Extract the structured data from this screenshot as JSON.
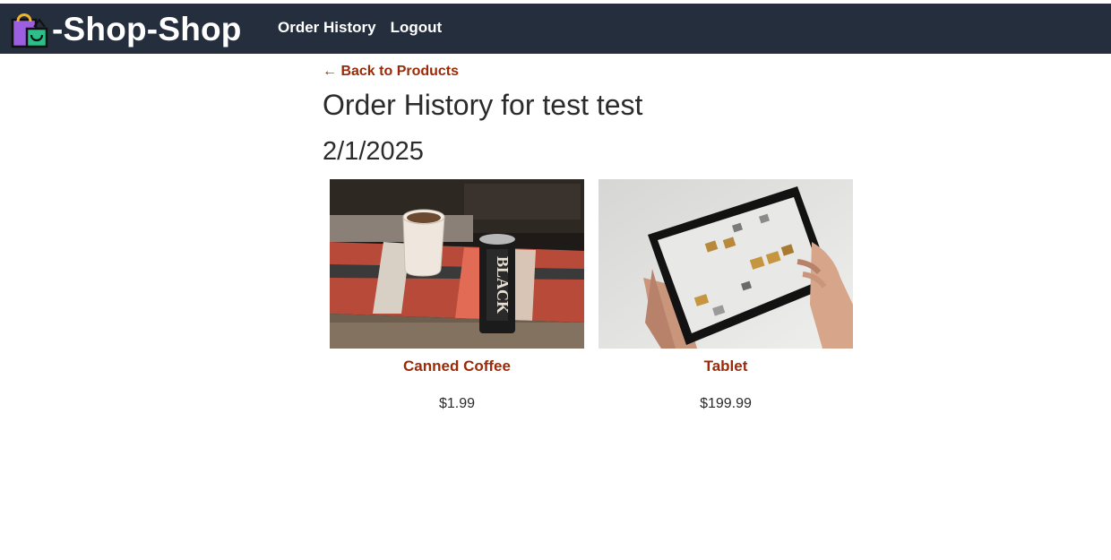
{
  "header": {
    "brand_icon": "shopping-bag-icon",
    "brand_text": "-Shop-Shop",
    "nav": [
      {
        "label": "Order History"
      },
      {
        "label": "Logout"
      }
    ],
    "background": "#252e3d"
  },
  "main": {
    "back_link": "← Back to Products",
    "title": "Order History for test test",
    "orders": [
      {
        "date": "2/1/2025",
        "items": [
          {
            "name": "Canned Coffee",
            "price": "$1.99",
            "image": "canned-coffee-photo"
          },
          {
            "name": "Tablet",
            "price": "$199.99",
            "image": "tablet-photo"
          }
        ]
      }
    ]
  },
  "colors": {
    "accent": "#9b2a08",
    "text": "#2b2b2b",
    "nav_text": "#ffffff"
  }
}
